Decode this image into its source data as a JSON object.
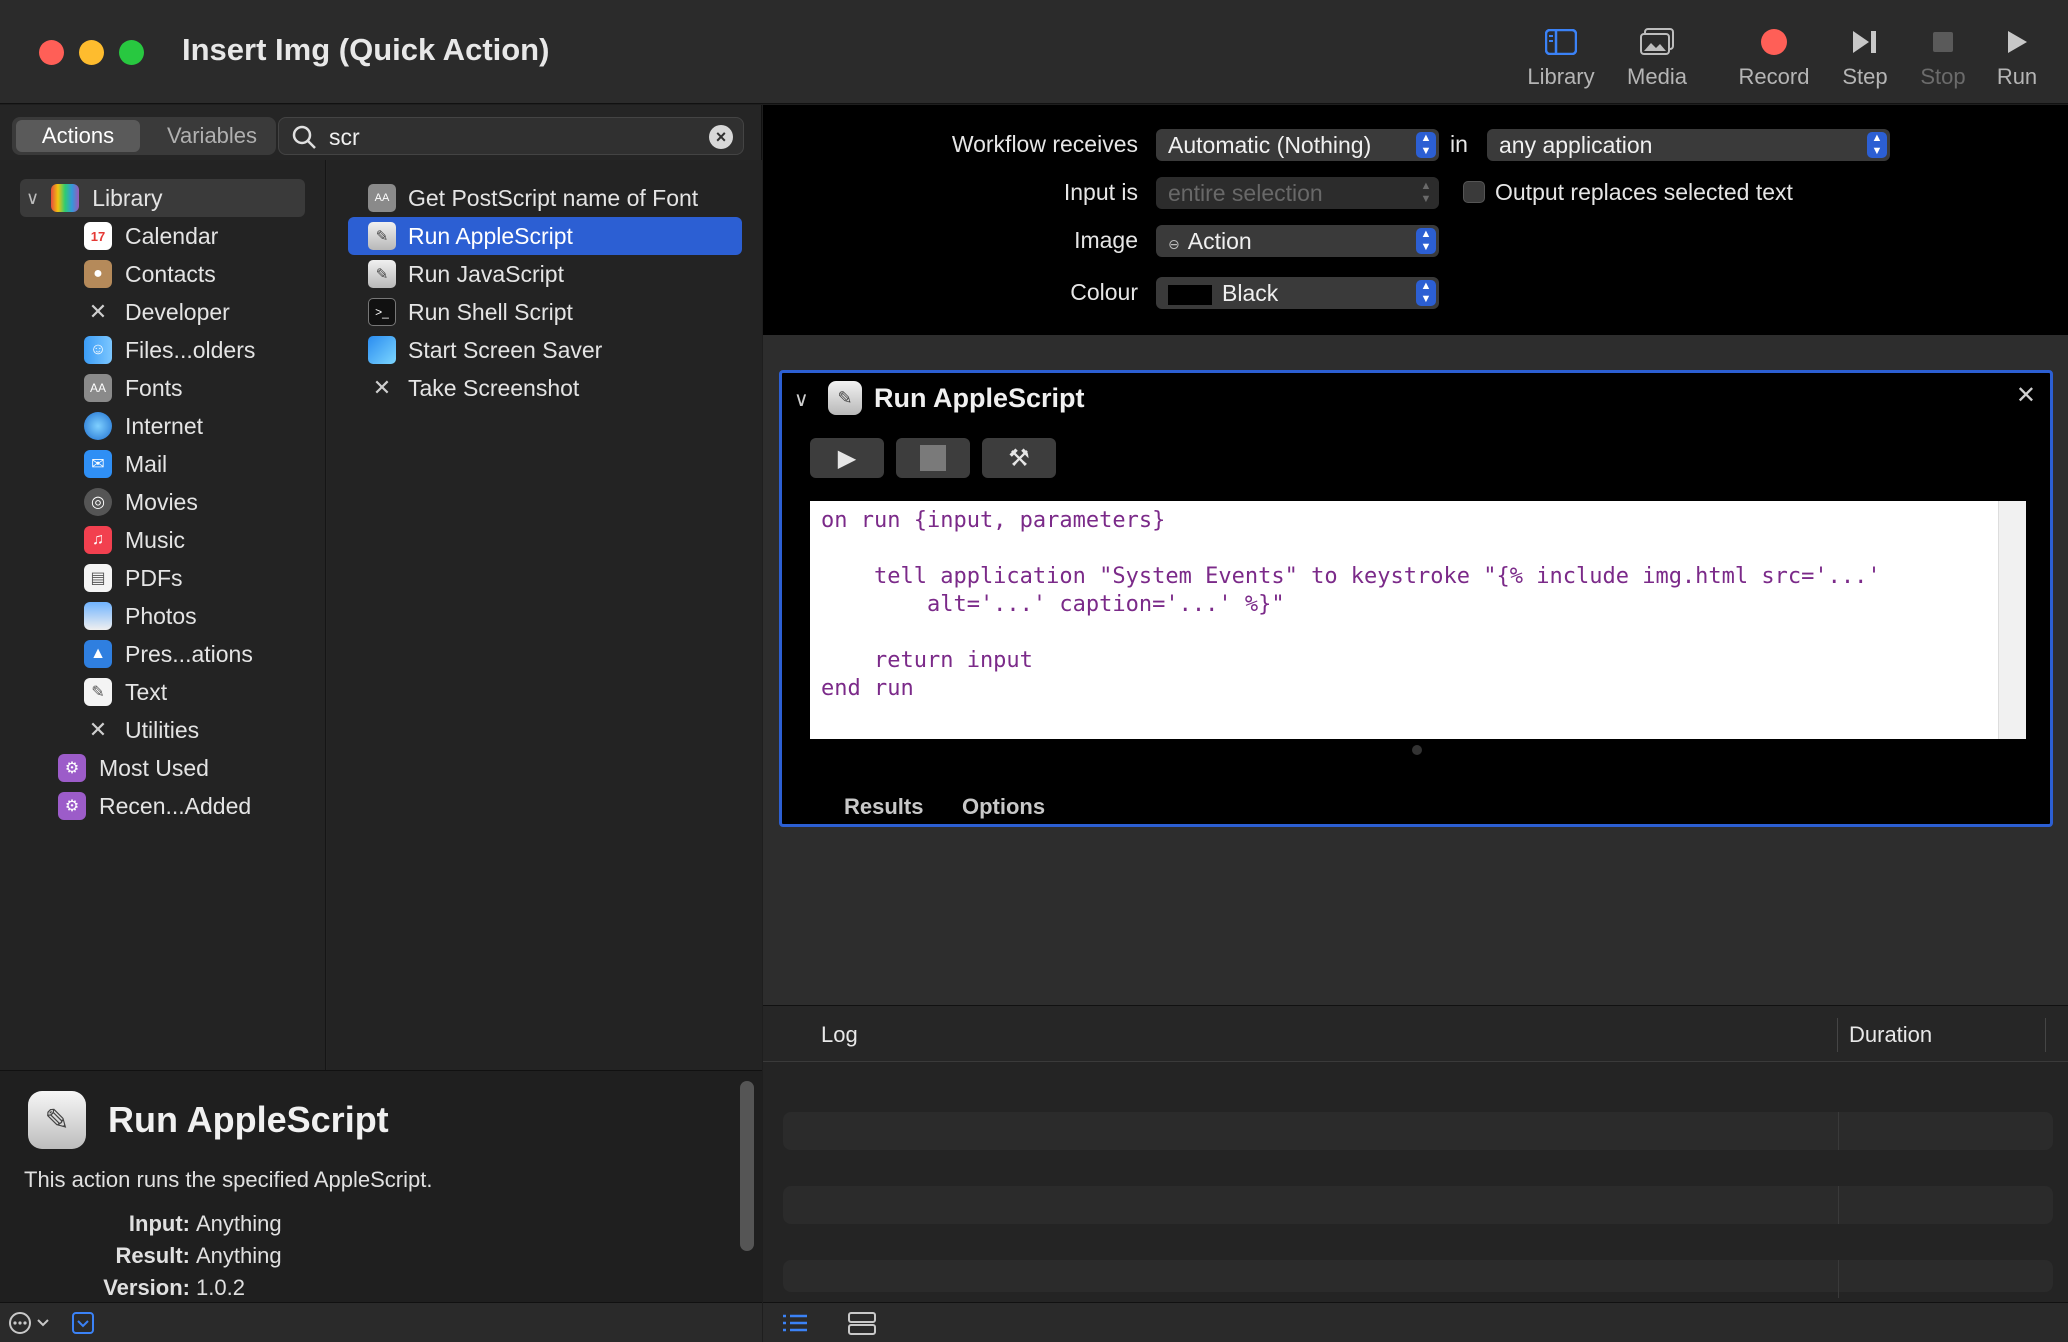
{
  "window": {
    "title": "Insert Img (Quick Action)"
  },
  "toolbar": {
    "library": "Library",
    "media": "Media",
    "record": "Record",
    "step": "Step",
    "stop": "Stop",
    "run": "Run"
  },
  "left": {
    "tabs": {
      "actions": "Actions",
      "variables": "Variables"
    },
    "search": {
      "value": "scr"
    },
    "library": {
      "root": "Library",
      "items": [
        "Calendar",
        "Contacts",
        "Developer",
        "Files...olders",
        "Fonts",
        "Internet",
        "Mail",
        "Movies",
        "Music",
        "PDFs",
        "Photos",
        "Pres...ations",
        "Text",
        "Utilities"
      ],
      "smart": [
        "Most Used",
        "Recen...Added"
      ]
    },
    "actions": [
      "Get PostScript name of Font",
      "Run AppleScript",
      "Run JavaScript",
      "Run Shell Script",
      "Start Screen Saver",
      "Take Screenshot"
    ],
    "selected_action": "Run AppleScript"
  },
  "description": {
    "title": "Run AppleScript",
    "text": "This action runs the specified AppleScript.",
    "input_label": "Input:",
    "input_value": "Anything",
    "result_label": "Result:",
    "result_value": "Anything",
    "version_label": "Version:",
    "version_value": "1.0.2"
  },
  "workflow": {
    "receives_label": "Workflow receives",
    "receives_value": "Automatic (Nothing)",
    "in_label": "in",
    "in_value": "any application",
    "input_is_label": "Input is",
    "input_is_value": "entire selection",
    "output_replaces": "Output replaces selected text",
    "image_label": "Image",
    "image_value": "Action",
    "colour_label": "Colour",
    "colour_value": "Black"
  },
  "action_card": {
    "title": "Run AppleScript",
    "code": "on run {input, parameters}\n\n    tell application \"System Events\" to keystroke \"{% include img.html src='...'\n        alt='...' caption='...' %}\"\n\n    return input\nend run",
    "tab_results": "Results",
    "tab_options": "Options"
  },
  "log": {
    "col_log": "Log",
    "col_duration": "Duration"
  },
  "colors": {
    "accent": "#2c5fd3",
    "record": "#ff5f57",
    "code_text": "#7b2a89"
  }
}
